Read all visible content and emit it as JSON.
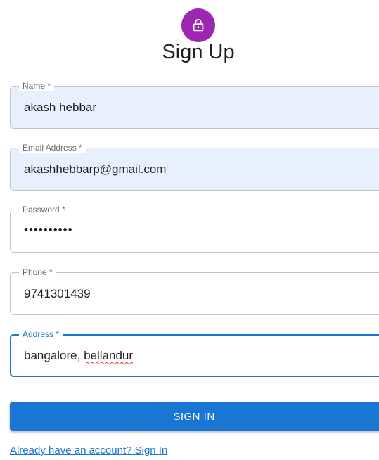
{
  "header": {
    "icon": "lock-icon",
    "icon_bg": "#9c27b0",
    "title": "Sign Up"
  },
  "form": {
    "name": {
      "label": "Name *",
      "value": "akash hebbar"
    },
    "email": {
      "label": "Email Address *",
      "value": "akashhebbarp@gmail.com"
    },
    "password": {
      "label": "Password *",
      "value": "••••••••••"
    },
    "phone": {
      "label": "Phone *",
      "value": "9741301439"
    },
    "address": {
      "label": "Address *",
      "value_prefix": "bangalore, ",
      "value_misspelled": "bellandur"
    }
  },
  "actions": {
    "submit_label": "SIGN IN",
    "link_label": "Already have an account? Sign In"
  },
  "colors": {
    "primary": "#1976d2",
    "autofill_bg": "#e8f0fe",
    "accent": "#9c27b0"
  }
}
